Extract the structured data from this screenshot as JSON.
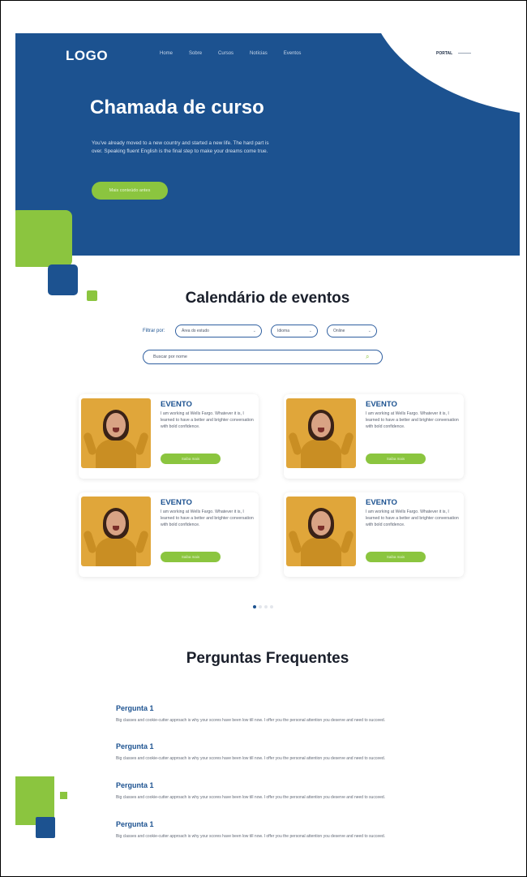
{
  "header": {
    "logo": "LOGO",
    "nav": [
      "Home",
      "Sobre",
      "Cursos",
      "Notícias",
      "Eventos"
    ],
    "portal": "PORTAL"
  },
  "hero": {
    "title": "Chamada de curso",
    "text": "You've already moved to a new country and started a new life. The hard part is over. Speaking fluent English is the final step to make your dreams come true.",
    "button": "Mais conteúdo antes"
  },
  "calendar": {
    "title": "Calendário de eventos",
    "filter_label": "Filtrar por:",
    "selects": [
      "Área do estudo",
      "Idioma",
      "Online"
    ],
    "search_placeholder": "Buscar por nome",
    "cards": [
      {
        "title": "EVENTO",
        "text": "I am working at Wells Fargo. Whatever it is, I learned to have a better and brighter conversation with bold confidence.",
        "button": "Saiba mais"
      },
      {
        "title": "EVENTO",
        "text": "I am working at Wells Fargo. Whatever it is, I learned to have a better and brighter conversation with bold confidence.",
        "button": "Saiba mais"
      },
      {
        "title": "EVENTO",
        "text": "I am working at Wells Fargo. Whatever it is, I learned to have a better and brighter conversation with bold confidence.",
        "button": "Saiba mais"
      },
      {
        "title": "EVENTO",
        "text": "I am working at Wells Fargo. Whatever it is, I learned to have a better and brighter conversation with bold confidence.",
        "button": "Saiba mais"
      }
    ]
  },
  "faq": {
    "title": "Perguntas Frequentes",
    "items": [
      {
        "q": "Pergunta 1",
        "a": "Big classes and cookie-cutter approach is why your scores have been low till now. I offer you the personal attention you deserve and need to succeed."
      },
      {
        "q": "Pergunta 1",
        "a": "Big classes and cookie-cutter approach is why your scores have been low till now. I offer you the personal attention you deserve and need to succeed."
      },
      {
        "q": "Pergunta 1",
        "a": "Big classes and cookie-cutter approach is why your scores have been low till now. I offer you the personal attention you deserve and need to succeed."
      },
      {
        "q": "Pergunta 1",
        "a": "Big classes and cookie-cutter approach is why your scores have been low till now. I offer you the personal attention you deserve and need to succeed."
      }
    ]
  },
  "colors": {
    "primary": "#1c5290",
    "accent": "#8bc53f"
  }
}
